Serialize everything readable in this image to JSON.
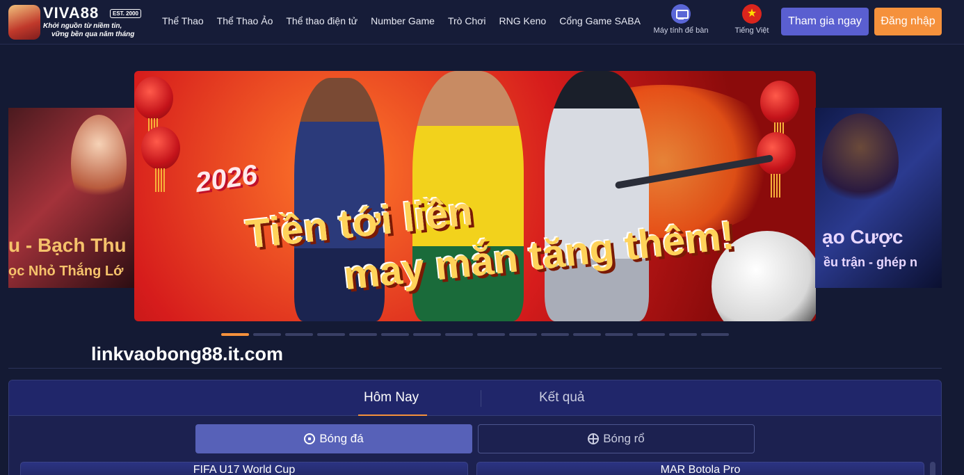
{
  "header": {
    "logo": {
      "wordmark": "VIVA88",
      "est": "EST. 2000",
      "tagline_line1": "Khởi nguồn từ niềm tin,",
      "tagline_line2": "vững bền qua năm tháng"
    },
    "nav": [
      {
        "label": "Thể Thao"
      },
      {
        "label": "Thể Thao Ảo"
      },
      {
        "label": "Thể thao điện tử"
      },
      {
        "label": "Number Game"
      },
      {
        "label": "Trò Chơi"
      },
      {
        "label": "RNG Keno"
      },
      {
        "label": "Cổng Game SABA"
      }
    ],
    "desktop_label": "Máy tính để bàn",
    "desktop_icon": "monitor-icon",
    "language_label": "Tiếng Việt",
    "language_icon": "vietnam-flag-icon",
    "join_label": "Tham gia ngay",
    "login_label": "Đăng nhập"
  },
  "carousel": {
    "left_banner": {
      "line1": "u - Bạch Thu",
      "line2": "ọc Nhỏ Thắng Lớ"
    },
    "right_banner": {
      "line1": "ạo Cược",
      "line2": "ều trận - ghép n"
    },
    "main_banner": {
      "year": "2026",
      "line1": "Tiền tới liền",
      "line2": "may mắn tăng thêm!"
    },
    "slide_count": 16,
    "active_slide": 1
  },
  "site_text": "linkvaobong88.it.com",
  "matches": {
    "tabs": [
      {
        "label": "Hôm Nay",
        "active": true
      },
      {
        "label": "Kết quả",
        "active": false
      }
    ],
    "sports": [
      {
        "label": "Bóng đá",
        "icon": "soccer-ball-icon",
        "active": true
      },
      {
        "label": "Bóng rổ",
        "icon": "basketball-icon",
        "active": false
      }
    ],
    "leagues": [
      {
        "title": "FIFA U17 World Cup"
      },
      {
        "title": "MAR Botola Pro"
      }
    ]
  },
  "colors": {
    "background": "#141a34",
    "accent_orange": "#f5913c",
    "accent_purple": "#5a5fd0",
    "panel": "#1c2150"
  }
}
